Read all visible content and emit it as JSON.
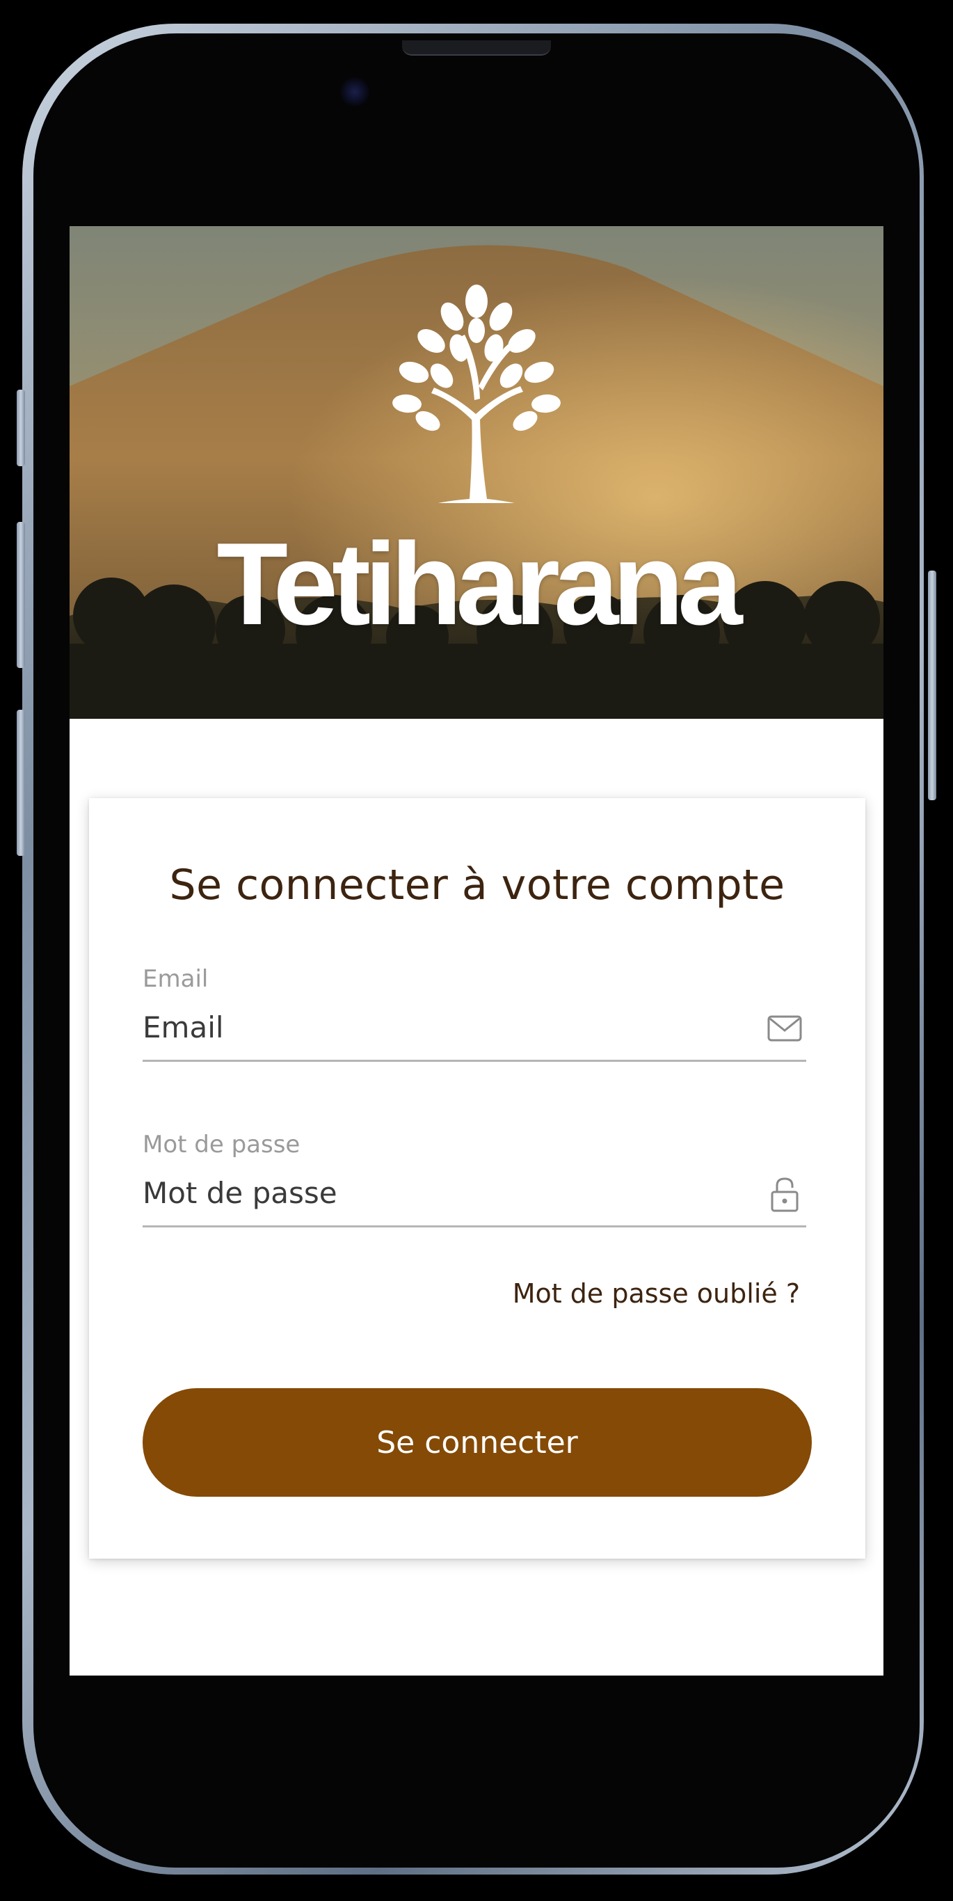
{
  "brand": {
    "name": "Tetiharana"
  },
  "login": {
    "title": "Se connecter à votre compte",
    "email_label": "Email",
    "email_placeholder": "Email",
    "password_label": "Mot de passe",
    "password_placeholder": "Mot de passe",
    "forgot_password": "Mot de passe oublié ?",
    "submit_label": "Se connecter"
  },
  "icons": {
    "email_field_icon": "envelope-icon",
    "password_field_icon": "lock-icon",
    "brand_logo": "tree-logo-icon"
  },
  "colors": {
    "primary_button": "#844a06",
    "title_text": "#3d2410",
    "label_text": "#9a9a9a",
    "input_underline": "#b5b5b5"
  }
}
